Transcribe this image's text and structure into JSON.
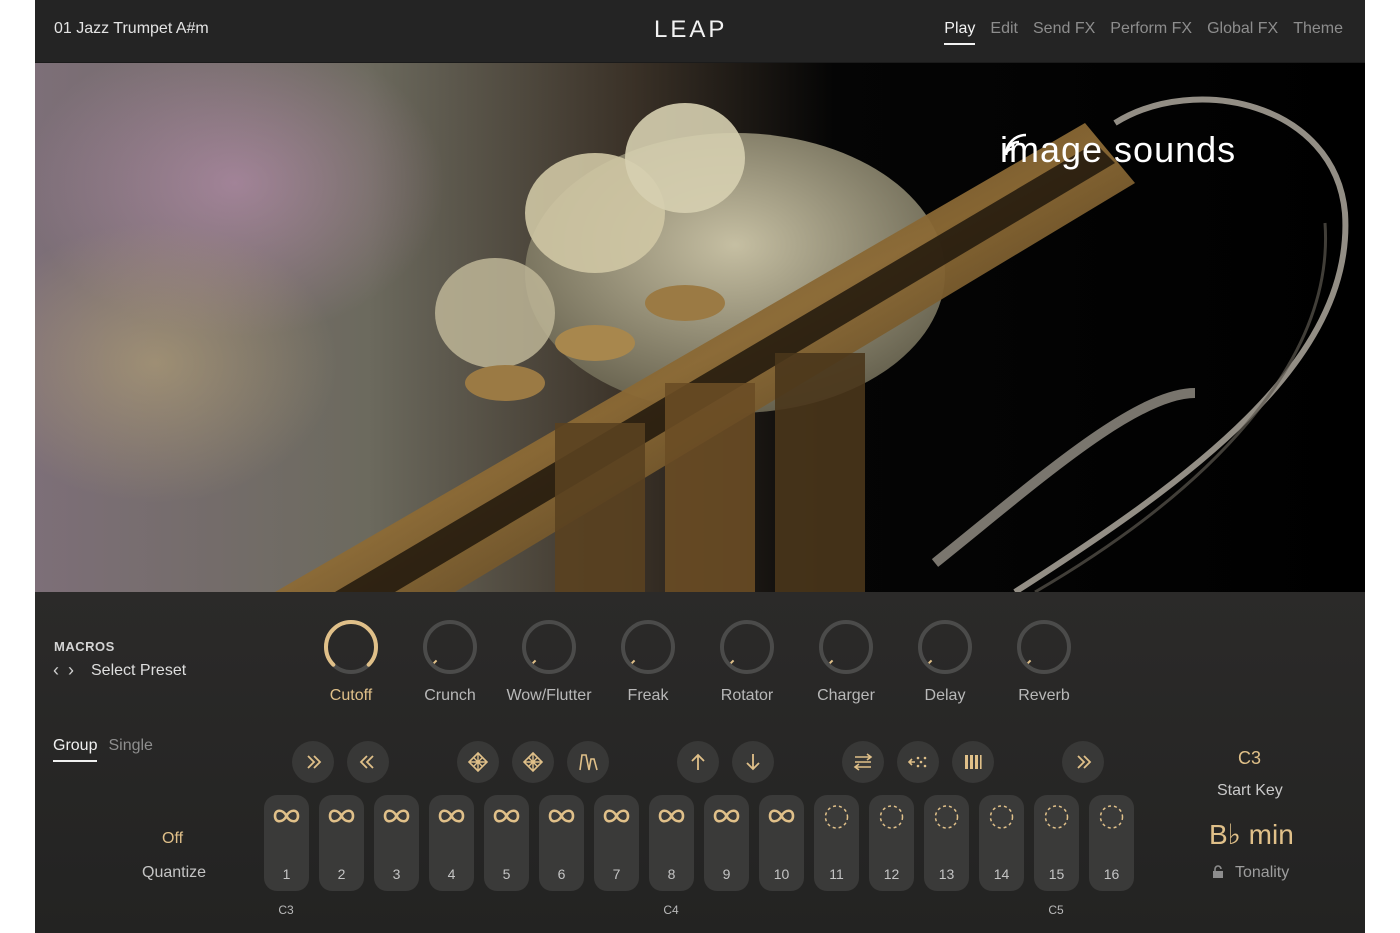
{
  "header": {
    "preset_name": "01 Jazz Trumpet A#m",
    "logo": "LEAP",
    "tabs": [
      {
        "label": "Play",
        "active": true
      },
      {
        "label": "Edit",
        "active": false
      },
      {
        "label": "Send FX",
        "active": false
      },
      {
        "label": "Perform FX",
        "active": false
      },
      {
        "label": "Global FX",
        "active": false
      },
      {
        "label": "Theme",
        "active": false
      }
    ]
  },
  "hero": {
    "brand": "image sounds",
    "brand_icon": "sound-waves-icon"
  },
  "macros": {
    "title": "MACROS",
    "select_preset": "Select Preset",
    "knobs": [
      {
        "label": "Cutoff",
        "value": 1.0,
        "active": true
      },
      {
        "label": "Crunch",
        "value": 0.0,
        "active": false
      },
      {
        "label": "Wow/Flutter",
        "value": 0.0,
        "active": false
      },
      {
        "label": "Freak",
        "value": 0.0,
        "active": false
      },
      {
        "label": "Rotator",
        "value": 0.0,
        "active": false
      },
      {
        "label": "Charger",
        "value": 0.0,
        "active": false
      },
      {
        "label": "Delay",
        "value": 0.0,
        "active": false
      },
      {
        "label": "Reverb",
        "value": 0.0,
        "active": false
      }
    ]
  },
  "mode_tabs": [
    {
      "label": "Group",
      "active": true
    },
    {
      "label": "Single",
      "active": false
    }
  ],
  "sequence_buttons": [
    {
      "icon": "fast-forward-icon"
    },
    {
      "icon": "rewind-icon"
    },
    {
      "icon": "diamond-grid-icon"
    },
    {
      "icon": "diamond-grid-icon"
    },
    {
      "icon": "envelope-shape-icon"
    },
    {
      "icon": "pitch-up-icon"
    },
    {
      "icon": "pitch-down-icon"
    },
    {
      "icon": "swap-direction-icon"
    },
    {
      "icon": "scatter-icon"
    },
    {
      "icon": "slices-icon"
    },
    {
      "icon": "fast-forward-icon"
    }
  ],
  "pads": [
    {
      "number": "1",
      "mode": "loop"
    },
    {
      "number": "2",
      "mode": "loop"
    },
    {
      "number": "3",
      "mode": "loop"
    },
    {
      "number": "4",
      "mode": "loop"
    },
    {
      "number": "5",
      "mode": "loop"
    },
    {
      "number": "6",
      "mode": "loop"
    },
    {
      "number": "7",
      "mode": "loop"
    },
    {
      "number": "8",
      "mode": "loop"
    },
    {
      "number": "9",
      "mode": "loop"
    },
    {
      "number": "10",
      "mode": "loop"
    },
    {
      "number": "11",
      "mode": "oneshot"
    },
    {
      "number": "12",
      "mode": "oneshot"
    },
    {
      "number": "13",
      "mode": "oneshot"
    },
    {
      "number": "14",
      "mode": "oneshot"
    },
    {
      "number": "15",
      "mode": "oneshot"
    },
    {
      "number": "16",
      "mode": "oneshot"
    }
  ],
  "key_labels": [
    {
      "label": "C3",
      "pad": 1
    },
    {
      "label": "C4",
      "pad": 8
    },
    {
      "label": "C5",
      "pad": 15
    }
  ],
  "quantize": {
    "value": "Off",
    "label": "Quantize"
  },
  "start_key": {
    "value": "C3",
    "label": "Start Key"
  },
  "tonality": {
    "value": "B♭ min",
    "label": "Tonality"
  },
  "colors": {
    "accent": "#e0c089",
    "background": "#262626",
    "pad": "#3a3a39"
  }
}
